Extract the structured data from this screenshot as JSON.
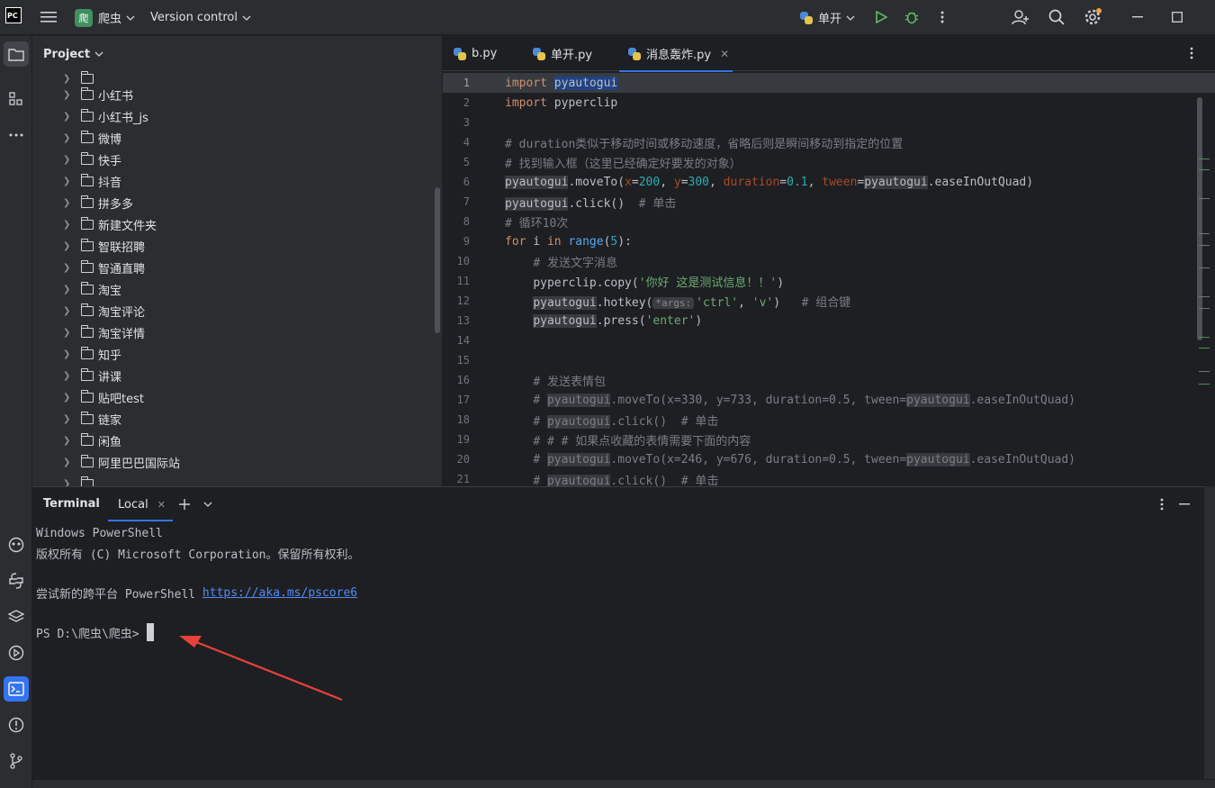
{
  "titlebar": {
    "app_logo": "PC",
    "project_badge": "爬",
    "project_name": "爬虫",
    "vcs_label": "Version control",
    "run_config": "单开"
  },
  "project_panel": {
    "title": "Project",
    "items": [
      "小红书",
      "小红书_js",
      "微博",
      "快手",
      "抖音",
      "拼多多",
      "新建文件夹",
      "智联招聘",
      "智通直聘",
      "淘宝",
      "淘宝评论",
      "淘宝详情",
      "知乎",
      "讲课",
      "贴吧test",
      "链家",
      "闲鱼",
      "阿里巴巴国际站"
    ]
  },
  "editor": {
    "tabs": [
      {
        "label": "b.py"
      },
      {
        "label": "单开.py"
      },
      {
        "label": "消息轰炸.py"
      }
    ],
    "line_numbers": [
      "1",
      "2",
      "3",
      "4",
      "5",
      "6",
      "7",
      "8",
      "9",
      "10",
      "11",
      "12",
      "13",
      "14",
      "15",
      "16",
      "17",
      "18",
      "19",
      "20",
      "21"
    ],
    "code": {
      "l1_kw": "import",
      "l1_mod": "pyautogui",
      "l2_kw": "import",
      "l2_mod": "pyperclip",
      "l4": "# duration类似于移动时间或移动速度，省略后则是瞬间移动到指定的位置",
      "l5": "# 找到输入框（这里已经确定好要发的对象）",
      "l6_obj": "pyautogui",
      "l6_call": ".moveTo(",
      "l6_px": "x",
      "l6_vx": "200",
      "l6_py": "y",
      "l6_vy": "300",
      "l6_pd": "duration",
      "l6_vd": "0.1",
      "l6_pt": "tween",
      "l6_obj2": "pyautogui",
      "l6_end": ".easeInOutQuad)",
      "l7_obj": "pyautogui",
      "l7_call": ".click()",
      "l7_cm": "# 单击",
      "l8": "# 循环10次",
      "l9_for": "for",
      "l9_i": " i ",
      "l9_in": "in",
      "l9_range": "range",
      "l9_num": "5",
      "l9_end": "):",
      "l10": "# 发送文字消息",
      "l11_call": "pyperclip.copy(",
      "l11_str": "'你好 这是测试信息！！'",
      "l11_end": ")",
      "l12_obj": "pyautogui",
      "l12_call": ".hotkey(",
      "l12_hint": "*args:",
      "l12_s1": "'ctrl'",
      "l12_s2": "'v'",
      "l12_cm": "# 组合键",
      "l13_obj": "pyautogui",
      "l13_call": ".press(",
      "l13_str": "'enter'",
      "l13_end": ")",
      "l16": "# 发送表情包",
      "l17_a": "# ",
      "l17_obj": "pyautogui",
      "l17_b": ".moveTo(x=330, y=733, duration=0.5, tween=",
      "l17_obj2": "pyautogui",
      "l17_c": ".easeInOutQuad)",
      "l18_a": "# ",
      "l18_obj": "pyautogui",
      "l18_b": ".click()  # 单击",
      "l19": "# # # 如果点收藏的表情需要下面的内容",
      "l20_a": "# ",
      "l20_obj": "pyautogui",
      "l20_b": ".moveTo(x=246, y=676, duration=0.5, tween=",
      "l20_obj2": "pyautogui",
      "l20_c": ".easeInOutQuad)",
      "l21_a": "# ",
      "l21_obj": "pyautogui",
      "l21_b": ".click()  # 单击"
    }
  },
  "terminal": {
    "title": "Terminal",
    "tab": "Local",
    "lines": {
      "l1": "Windows PowerShell",
      "l2": "版权所有 (C) Microsoft Corporation。保留所有权利。",
      "l3_text": "尝试新的跨平台 PowerShell ",
      "l3_link": "https://aka.ms/pscore6",
      "prompt": "PS D:\\爬虫\\爬虫>"
    }
  },
  "colors": {
    "accent": "#3574f0",
    "annotation_arrow": "#e8413b"
  }
}
